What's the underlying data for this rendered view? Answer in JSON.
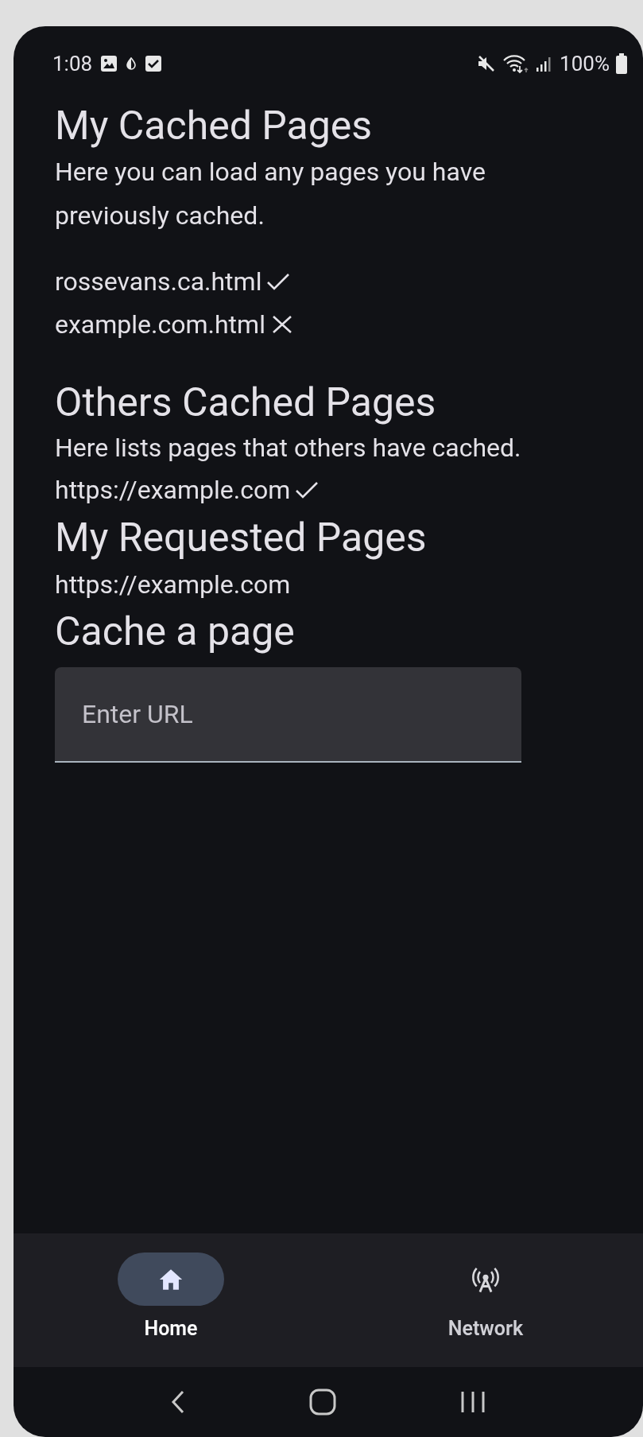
{
  "status_bar": {
    "time": "1:08",
    "battery": "100%"
  },
  "my_cached": {
    "title": "My Cached Pages",
    "description": "Here you can load any pages you have previously cached.",
    "items": [
      {
        "name": "rossevans.ca.html",
        "cached": true
      },
      {
        "name": "example.com.html",
        "cached": false
      }
    ]
  },
  "others_cached": {
    "title": "Others Cached Pages",
    "description": "Here lists pages that others have cached.",
    "items": [
      {
        "name": "https://example.com",
        "cached": true
      }
    ]
  },
  "requested": {
    "title": "My Requested Pages",
    "items": [
      "https://example.com"
    ]
  },
  "cache_form": {
    "title": "Cache a page",
    "placeholder": "Enter URL"
  },
  "bottom_nav": [
    {
      "label": "Home",
      "kind": "home",
      "selected": true
    },
    {
      "label": "Network",
      "kind": "network",
      "selected": false
    }
  ]
}
